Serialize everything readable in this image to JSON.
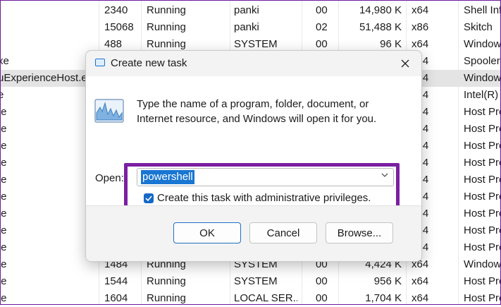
{
  "background_table": {
    "rows": [
      {
        "name": "",
        "pid": "2340",
        "status": "Running",
        "user": "panki",
        "cpu": "00",
        "mem": "14,980 K",
        "arch": "x64",
        "desc": "Shell Inf"
      },
      {
        "name": "",
        "pid": "15068",
        "status": "Running",
        "user": "panki",
        "cpu": "02",
        "mem": "51,488 K",
        "arch": "x86",
        "desc": "Skitch"
      },
      {
        "name": "",
        "pid": "488",
        "status": "Running",
        "user": "SYSTEM",
        "cpu": "00",
        "mem": "96 K",
        "arch": "x64",
        "desc": "Window"
      },
      {
        "name": "xe",
        "pid": "",
        "status": "",
        "user": "",
        "cpu": "",
        "mem": "",
        "arch": "x64",
        "desc": "Spooler"
      },
      {
        "name": "uExperienceHost.ex",
        "pid": "",
        "status": "",
        "user": "",
        "cpu": "",
        "mem": "",
        "arch": "x64",
        "desc": "Window"
      },
      {
        "name": "e",
        "pid": "",
        "status": "",
        "user": "",
        "cpu": "",
        "mem": "",
        "arch": "x64",
        "desc": "Intel(R)"
      },
      {
        "name": "te",
        "pid": "",
        "status": "",
        "user": "",
        "cpu": "",
        "mem": "",
        "arch": "x64",
        "desc": "Host Pro"
      },
      {
        "name": "te",
        "pid": "",
        "status": "",
        "user": "",
        "cpu": "",
        "mem": "",
        "arch": "x64",
        "desc": "Host Pro"
      },
      {
        "name": "te",
        "pid": "",
        "status": "",
        "user": "",
        "cpu": "",
        "mem": "",
        "arch": "x64",
        "desc": "Host Pro"
      },
      {
        "name": "te",
        "pid": "",
        "status": "",
        "user": "",
        "cpu": "",
        "mem": "",
        "arch": "x64",
        "desc": "Host Pro"
      },
      {
        "name": "te",
        "pid": "",
        "status": "",
        "user": "",
        "cpu": "",
        "mem": "",
        "arch": "x64",
        "desc": "Host Pro"
      },
      {
        "name": "te",
        "pid": "",
        "status": "",
        "user": "",
        "cpu": "",
        "mem": "",
        "arch": "x64",
        "desc": "Host Pro"
      },
      {
        "name": "te",
        "pid": "",
        "status": "",
        "user": "",
        "cpu": "",
        "mem": "",
        "arch": "x64",
        "desc": "Host Pro"
      },
      {
        "name": "te",
        "pid": "",
        "status": "",
        "user": "",
        "cpu": "",
        "mem": "",
        "arch": "x64",
        "desc": "Host Pro"
      },
      {
        "name": "te",
        "pid": "",
        "status": "",
        "user": "",
        "cpu": "",
        "mem": "",
        "arch": "x64",
        "desc": "Host Pro"
      },
      {
        "name": "te",
        "pid": "1484",
        "status": "Running",
        "user": "SYSTEM",
        "cpu": "00",
        "mem": "4,424 K",
        "arch": "x64",
        "desc": "Window"
      },
      {
        "name": "te",
        "pid": "1544",
        "status": "Running",
        "user": "SYSTEM",
        "cpu": "00",
        "mem": "956 K",
        "arch": "x64",
        "desc": "Host Pro"
      },
      {
        "name": "te",
        "pid": "1604",
        "status": "Running",
        "user": "LOCAL SER...",
        "cpu": "00",
        "mem": "1,704 K",
        "arch": "x64",
        "desc": "Host Pro"
      }
    ]
  },
  "dialog": {
    "title": "Create new task",
    "close_icon": "close-icon",
    "description": "Type the name of a program, folder, document, or Internet resource, and Windows will open it for you.",
    "open_label": "Open:",
    "open_value": "powershell",
    "admin_checkbox_checked": true,
    "admin_label": "Create this task with administrative privileges.",
    "buttons": {
      "ok": "OK",
      "cancel": "Cancel",
      "browse": "Browse..."
    }
  },
  "colors": {
    "highlight": "#7b1fa2",
    "selection": "#1976d2"
  }
}
